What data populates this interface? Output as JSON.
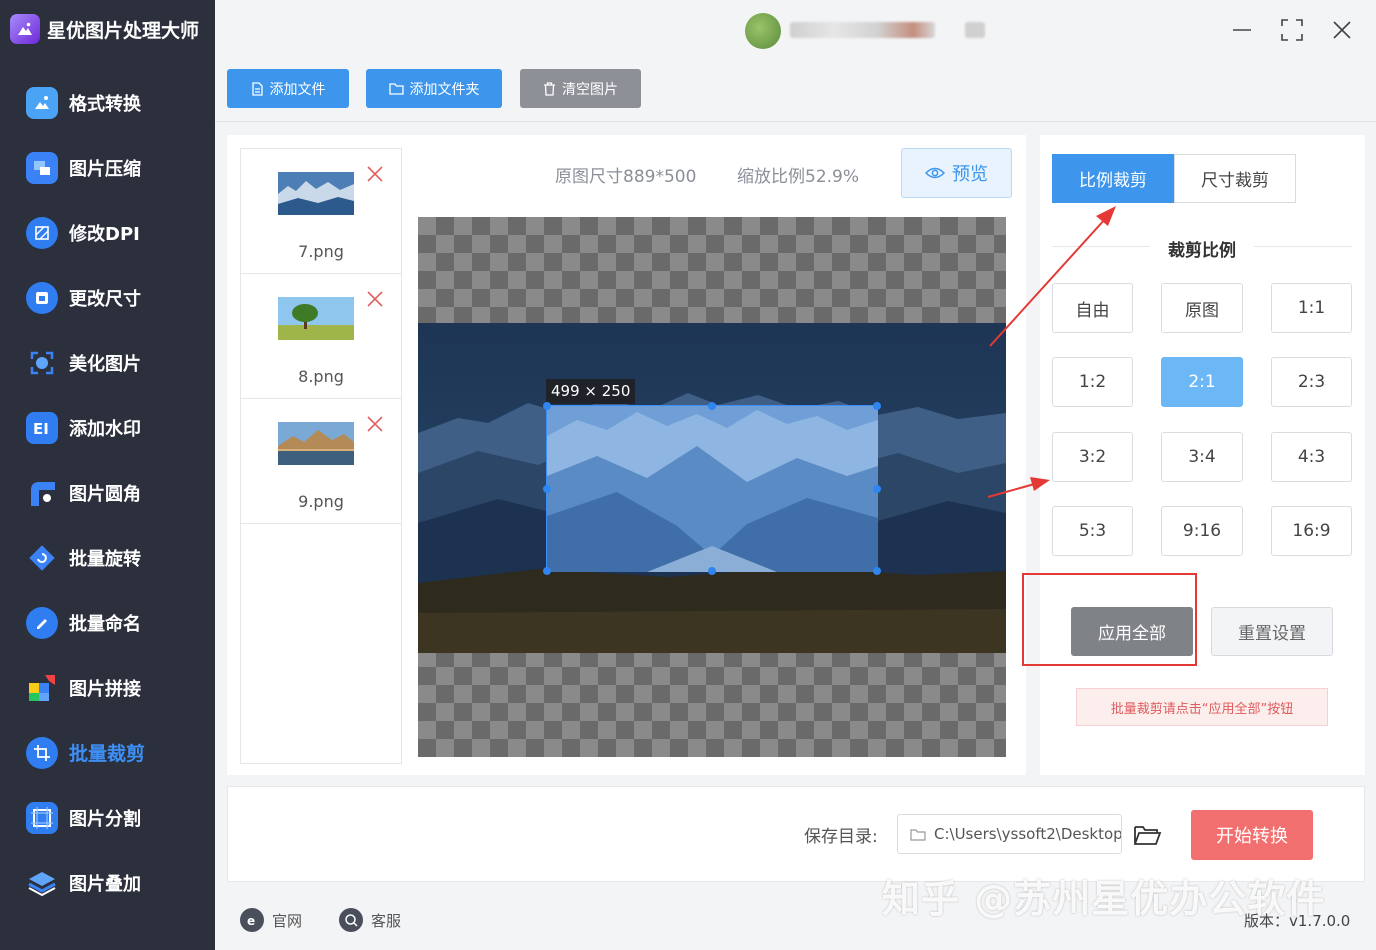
{
  "app": {
    "name": "星优图片处理大师"
  },
  "sidebar": {
    "items": [
      {
        "label": "格式转换",
        "icon": "image-convert-icon"
      },
      {
        "label": "图片压缩",
        "icon": "compress-icon"
      },
      {
        "label": "修改DPI",
        "icon": "dpi-icon"
      },
      {
        "label": "更改尺寸",
        "icon": "resize-icon"
      },
      {
        "label": "美化图片",
        "icon": "beautify-icon"
      },
      {
        "label": "添加水印",
        "icon": "watermark-icon"
      },
      {
        "label": "图片圆角",
        "icon": "rounded-corner-icon"
      },
      {
        "label": "批量旋转",
        "icon": "rotate-icon"
      },
      {
        "label": "批量命名",
        "icon": "rename-icon"
      },
      {
        "label": "图片拼接",
        "icon": "puzzle-icon"
      },
      {
        "label": "批量裁剪",
        "icon": "crop-icon",
        "active": true
      },
      {
        "label": "图片分割",
        "icon": "split-icon"
      },
      {
        "label": "图片叠加",
        "icon": "layers-icon"
      }
    ]
  },
  "toolbar": {
    "add_file": "添加文件",
    "add_folder": "添加文件夹",
    "clear": "清空图片"
  },
  "files": [
    {
      "name": "7.png"
    },
    {
      "name": "8.png"
    },
    {
      "name": "9.png"
    }
  ],
  "preview": {
    "original_size": "原图尺寸889*500",
    "zoom": "缩放比例52.9%",
    "preview_label": "预览",
    "crop_size": "499 × 250"
  },
  "crop": {
    "tab_ratio": "比例裁剪",
    "tab_size": "尺寸裁剪",
    "section_title": "裁剪比例",
    "ratios": [
      "自由",
      "原图",
      "1:1",
      "1:2",
      "2:1",
      "2:3",
      "3:2",
      "3:4",
      "4:3",
      "5:3",
      "9:16",
      "16:9"
    ],
    "selected": "2:1",
    "apply_all": "应用全部",
    "reset": "重置设置",
    "hint": "批量裁剪请点击“应用全部”按钮"
  },
  "output": {
    "save_label": "保存目录:",
    "save_path": "C:\\Users\\yssoft2\\Desktop",
    "start": "开始转换"
  },
  "footer": {
    "website": "官网",
    "support": "客服",
    "version": "版本：v1.7.0.0"
  },
  "watermark": "知乎 @苏州星优办公软件",
  "colors": {
    "sidebar_bg": "#2b303c",
    "accent": "#3d8ff5",
    "start_button": "#f26f6f",
    "annotation_red": "#e53935"
  }
}
